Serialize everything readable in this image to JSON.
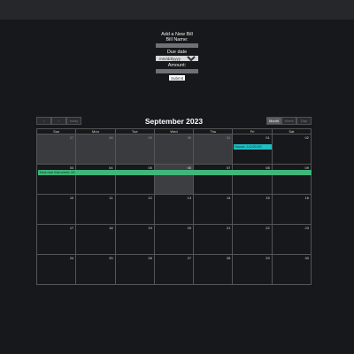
{
  "form": {
    "title": "Add a New Bill",
    "bill_name_label": "Bill Name:",
    "bill_name_placeholder": "Bill Name",
    "due_date_label": "Due date",
    "due_date_value": "mm/dd/yyyy",
    "amount_label": "Amount:",
    "amount_placeholder": "Amount",
    "submit_label": "Submit"
  },
  "toolbar": {
    "title": "September 2023",
    "nav_buttons": [
      "‹",
      "›",
      "today"
    ],
    "views": [
      "Month",
      "Week",
      "Day"
    ],
    "active_view": "Month"
  },
  "calendar": {
    "weekdays": [
      "Sun",
      "Mon",
      "Tue",
      "Wed",
      "Thu",
      "Fri",
      "Sat"
    ],
    "weeks": [
      [
        {
          "d": "27",
          "other": true
        },
        {
          "d": "28",
          "other": true
        },
        {
          "d": "29",
          "other": true
        },
        {
          "d": "30",
          "other": true
        },
        {
          "d": "31",
          "other": true
        },
        {
          "d": "01",
          "other": false
        },
        {
          "d": "02",
          "other": false
        }
      ],
      [
        {
          "d": "03",
          "other": false
        },
        {
          "d": "04",
          "other": false
        },
        {
          "d": "05",
          "other": false
        },
        {
          "d": "06",
          "other": false,
          "today": true
        },
        {
          "d": "07",
          "other": false
        },
        {
          "d": "08",
          "other": false
        },
        {
          "d": "09",
          "other": false
        }
      ],
      [
        {
          "d": "10",
          "other": false
        },
        {
          "d": "11",
          "other": false
        },
        {
          "d": "12",
          "other": false
        },
        {
          "d": "13",
          "other": false
        },
        {
          "d": "14",
          "other": false
        },
        {
          "d": "15",
          "other": false
        },
        {
          "d": "16",
          "other": false
        }
      ],
      [
        {
          "d": "17",
          "other": false
        },
        {
          "d": "18",
          "other": false
        },
        {
          "d": "19",
          "other": false
        },
        {
          "d": "20",
          "other": false
        },
        {
          "d": "21",
          "other": false
        },
        {
          "d": "22",
          "other": false
        },
        {
          "d": "23",
          "other": false
        }
      ],
      [
        {
          "d": "24",
          "other": false
        },
        {
          "d": "25",
          "other": false
        },
        {
          "d": "26",
          "other": false
        },
        {
          "d": "27",
          "other": false
        },
        {
          "d": "28",
          "other": false
        },
        {
          "d": "29",
          "other": false
        },
        {
          "d": "30",
          "other": false
        }
      ]
    ],
    "events": {
      "house": "House: 1/1/20.00",
      "total": "Total due this week: 00"
    }
  }
}
